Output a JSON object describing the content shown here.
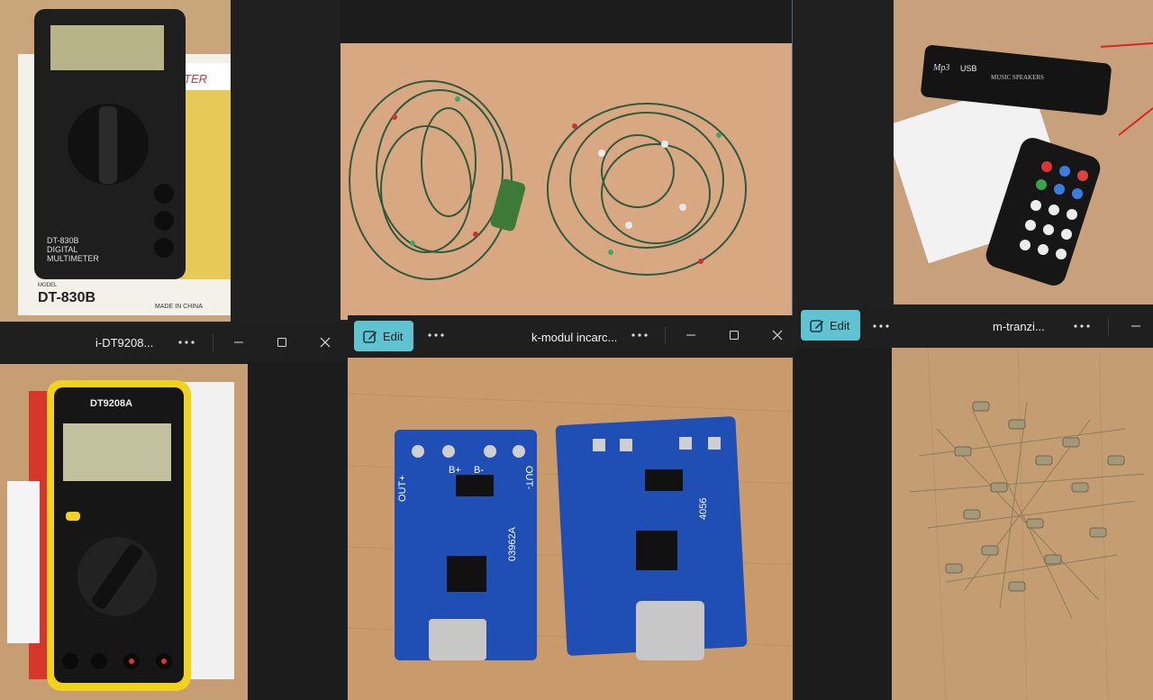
{
  "windows": {
    "w1": {
      "title": "i-DT9208..."
    },
    "w2": {
      "edit_label": "Edit",
      "title": "k-modul incarc..."
    },
    "w3": {
      "edit_label": "Edit",
      "title": "m-tranzi..."
    }
  },
  "photos": {
    "dt830b": {
      "brand": "DT-830B",
      "line1": "DT-830B",
      "line2": "DIGITAL",
      "line3": "MULTIMETER",
      "box": "DT-830B",
      "made": "MADE IN CHINA",
      "model": "MODEL"
    },
    "dt9208a": {
      "brand": "DT9208A"
    },
    "mp3": {
      "label1": "Mp3",
      "label2": "USB",
      "label3": "MUSIC SPEAKERS"
    },
    "pcb": {
      "left_text": "03962A",
      "right_text": "4056",
      "outp": "OUT+",
      "outm": "OUT-",
      "bp": "B+",
      "bm": "B-"
    }
  },
  "colors": {
    "accent": "#5fc3d1",
    "titlebar": "#1f1f1f"
  },
  "icons": {
    "edit": "edit-photo-icon",
    "more": "more-icon",
    "min": "minimize-icon",
    "max": "maximize-icon",
    "close": "close-icon"
  }
}
